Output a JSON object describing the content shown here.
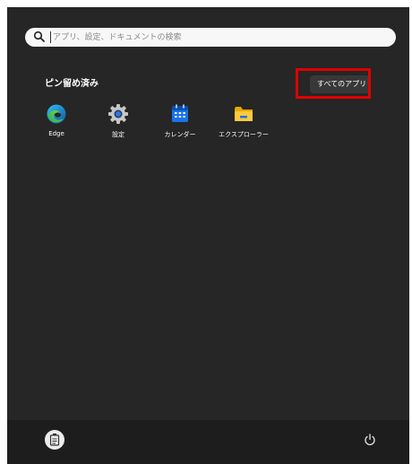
{
  "search": {
    "placeholder": "アプリ、設定、ドキュメントの検索"
  },
  "pinned": {
    "title": "ピン留め済み",
    "all_apps_label": "すべてのアプリ",
    "apps": [
      {
        "label": "Edge",
        "icon": "edge-icon"
      },
      {
        "label": "設定",
        "icon": "gear-icon"
      },
      {
        "label": "カレンダー",
        "icon": "calendar-icon"
      },
      {
        "label": "エクスプローラー",
        "icon": "folder-icon"
      }
    ]
  },
  "taskbar": {
    "user_icon": "user-avatar",
    "power_icon": "power-icon"
  },
  "colors": {
    "panel": "#262626",
    "taskbar": "#1d1d1d",
    "highlight": "#e00000",
    "accent": "#0078d4"
  }
}
